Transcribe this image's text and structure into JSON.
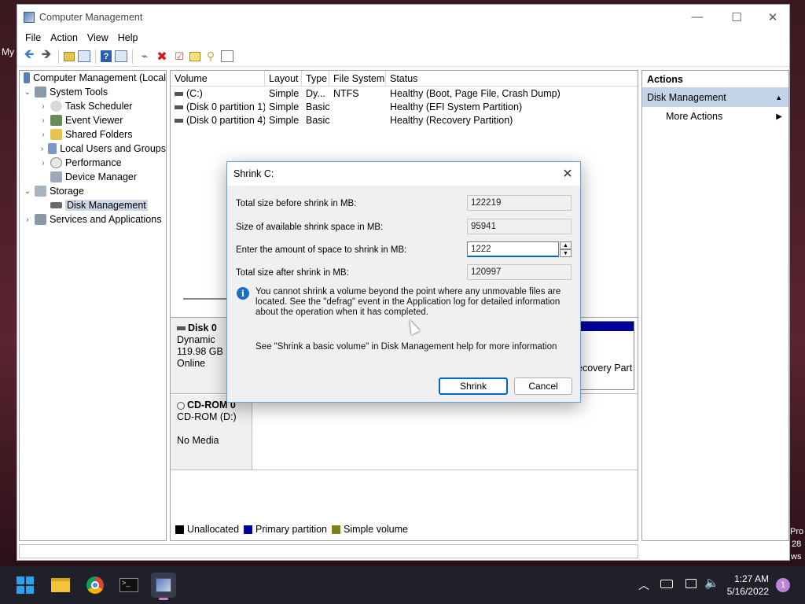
{
  "window": {
    "title": "Computer Management",
    "minimize": "—",
    "maximize": "☐",
    "close": "✕"
  },
  "menu": [
    "File",
    "Action",
    "View",
    "Help"
  ],
  "tree": {
    "root": "Computer Management (Local",
    "system_tools": "System Tools",
    "task_scheduler": "Task Scheduler",
    "event_viewer": "Event Viewer",
    "shared_folders": "Shared Folders",
    "local_users": "Local Users and Groups",
    "performance": "Performance",
    "device_manager": "Device Manager",
    "storage": "Storage",
    "disk_management": "Disk Management",
    "services": "Services and Applications"
  },
  "volumes": {
    "headers": [
      "Volume",
      "Layout",
      "Type",
      "File System",
      "Status"
    ],
    "rows": [
      [
        "(C:)",
        "Simple",
        "Dy...",
        "NTFS",
        "Healthy (Boot, Page File, Crash Dump)"
      ],
      [
        "(Disk 0 partition 1)",
        "Simple",
        "Basic",
        "",
        "Healthy (EFI System Partition)"
      ],
      [
        "(Disk 0 partition 4)",
        "Simple",
        "Basic",
        "",
        "Healthy (Recovery Partition)"
      ]
    ]
  },
  "disks": {
    "disk0": {
      "name": "Disk 0",
      "type": "Dynamic",
      "size": "119.98 GB",
      "status": "Online",
      "partition_fragment": "ecovery Part"
    },
    "cdrom": {
      "name": "CD-ROM 0",
      "drive": "CD-ROM (D:)",
      "media": "No Media"
    }
  },
  "legend": [
    {
      "label": "Unallocated",
      "color": "#000000"
    },
    {
      "label": "Primary partition",
      "color": "#00009a"
    },
    {
      "label": "Simple volume",
      "color": "#7f7f1c"
    }
  ],
  "actions": {
    "header": "Actions",
    "selected": "Disk Management",
    "more": "More Actions"
  },
  "dialog": {
    "title": "Shrink C:",
    "close": "✕",
    "total_label": "Total size before shrink in MB:",
    "total_value": "122219",
    "available_label": "Size of available shrink space in MB:",
    "available_value": "95941",
    "enter_label": "Enter the amount of space to shrink in MB:",
    "enter_value": "1222",
    "after_label": "Total size after shrink in MB:",
    "after_value": "120997",
    "info_text": "You cannot shrink a volume beyond the point where any unmovable files are located. See the \"defrag\" event in the Application log for detailed information about the operation when it has completed.",
    "help_text": "See \"Shrink a basic volume\" in Disk Management help for more information",
    "shrink_button": "Shrink",
    "cancel_button": "Cancel"
  },
  "desktop": {
    "left_label": "My",
    "right_labels": [
      "Pro",
      "28",
      "ws"
    ]
  },
  "taskbar": {
    "time": "1:27 AM",
    "date": "5/16/2022",
    "notification_count": "1"
  }
}
